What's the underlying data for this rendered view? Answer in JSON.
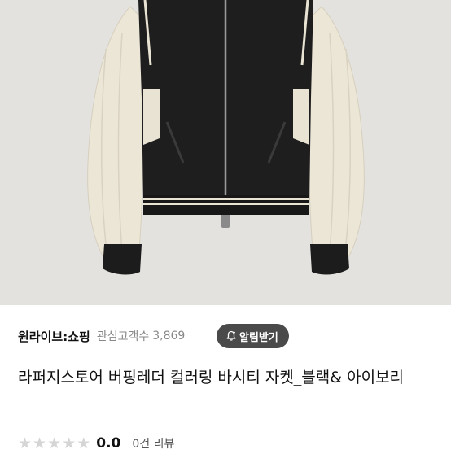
{
  "product": {
    "image_alt": "Leather varsity jacket photo",
    "title": "라퍼지스토어 버핑레더 컬러링 바시티 자켓_블랙& 아이보리",
    "rating_stars": 5,
    "rating_value": "0.0",
    "review_count": "0건 리뷰"
  },
  "store": {
    "name": "원라이브:쇼핑",
    "follower_label": "관심고객수",
    "follower_count": "3,869",
    "notify_label": "알림받기",
    "notify_icon": "bell-plus-icon"
  },
  "colors": {
    "photo_bg": "#e3e2df",
    "notify_btn_bg": "#4a4a4a",
    "star_empty": "#d5d5d5"
  }
}
